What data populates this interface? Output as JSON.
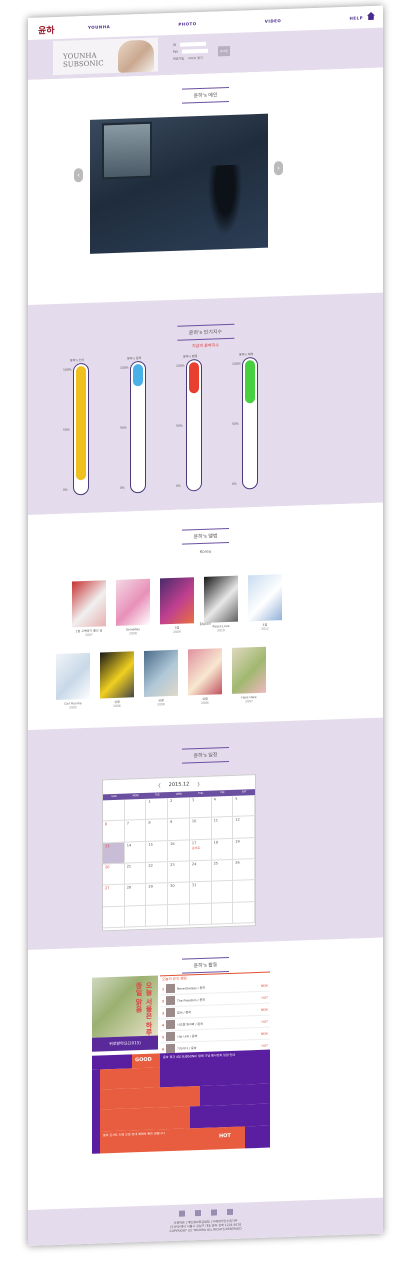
{
  "header": {
    "logo": "윤하",
    "nav": [
      "YOUNHA",
      "PHOTO",
      "VIDEO",
      "HELP"
    ],
    "banner_line1": "YOUNHA",
    "banner_line2": "SUBSONIC",
    "login_labels": [
      "ID",
      "PW",
      "회원가입"
    ],
    "login_link": "아이디 찾기",
    "login_button": "로그인"
  },
  "hero": {
    "title": "윤하's 메인"
  },
  "temperature": {
    "title": "윤하's 인기지수",
    "subtitle": "지금의 윤하지수",
    "labels": [
      "윤하's 인기",
      "윤하's 음악",
      "윤하's 팬덤",
      "윤하's 매력"
    ],
    "ticks": [
      "100%",
      "50%",
      "0%"
    ],
    "levels": [
      0.92,
      0.18,
      0.25,
      0.35
    ],
    "colors": [
      "#f0c020",
      "#4ab0e8",
      "#e84030",
      "#48d040"
    ]
  },
  "albums": {
    "title": "윤하's 앨범",
    "group1": "Korea",
    "group2": "Japan",
    "row1": [
      {
        "name": "1집 고백하기 좋은 날",
        "year": "2007"
      },
      {
        "name": "Someday",
        "year": "2008"
      },
      {
        "name": "3집",
        "year": "2009"
      },
      {
        "name": "Peace Love",
        "year": "2010"
      },
      {
        "name": "4집",
        "year": "2012"
      }
    ],
    "row2": [
      {
        "name": "Go! Younha",
        "year": "2005"
      },
      {
        "name": "싱글",
        "year": "2006"
      },
      {
        "name": "싱글",
        "year": "2006"
      },
      {
        "name": "싱글",
        "year": "2006"
      },
      {
        "name": "Hare Hare",
        "year": "2007"
      }
    ]
  },
  "calendar": {
    "title": "윤하's 일정",
    "month": "2015.12",
    "prev": "〈",
    "next": "〉",
    "weekdays": [
      "SUN",
      "MON",
      "TUE",
      "WED",
      "THU",
      "FRI",
      "SAT"
    ],
    "event": "콘서트"
  },
  "activity": {
    "title": "윤하's 활동",
    "photo_text": "오늘 서울은 하루종일 맑음",
    "photo_caption": "위로받아요(2015)",
    "chart_title": "오늘의 뮤직 랭킹",
    "chart_rows": [
      {
        "rank": "1",
        "name": "Nevertheless / 윤하",
        "tag": "NEW"
      },
      {
        "rank": "2",
        "name": "The Freedom / 윤하",
        "tag": "HOT"
      },
      {
        "rank": "3",
        "name": "없어 / 윤하",
        "tag": "NEW"
      },
      {
        "rank": "4",
        "name": "시간을 믿어봐 / 윤하",
        "tag": "HOT"
      },
      {
        "rank": "5",
        "name": "너는 나의 / 윤하",
        "tag": "NEW"
      },
      {
        "rank": "6",
        "name": "기다리다 / 윤하",
        "tag": "HOT"
      }
    ],
    "good_label": "GOOD",
    "hot_label": "HOT",
    "good_text": "윤하 정규 4집 SUBSONIC 발매 기념 팬사인회 일정 안내",
    "hot_text": "윤하 콘서트 티켓 오픈 안내 예매처 확인 바랍니다"
  },
  "footer": {
    "line1": "이용약관 | 개인정보취급방침 | 이메일무단수집거부",
    "line2": "(주)위드메이 서울시 강남구 대표 윤하 전화 1234-5678",
    "line3": "COPYRIGHT (C) YOUNHA ALL RIGHTS RESERVED"
  }
}
